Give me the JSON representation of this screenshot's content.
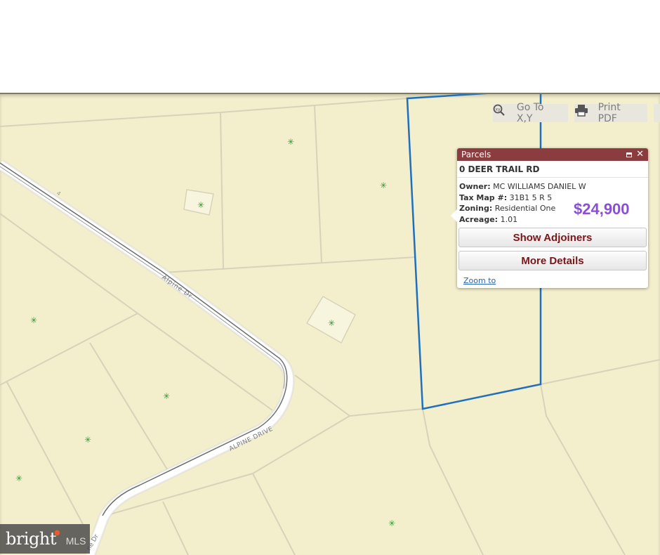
{
  "toolbar": {
    "goto_label": "Go To X,Y",
    "print_label": "Print PDF",
    "goto_icon": "zoom-xy-icon",
    "print_icon": "printer-icon"
  },
  "popup": {
    "header": "Parcels",
    "title": "0 DEER TRAIL RD",
    "fields": [
      {
        "label": "Owner:",
        "value": "MC WILLIAMS DANIEL W"
      },
      {
        "label": "Tax Map #:",
        "value": "31B1 5 R 5"
      },
      {
        "label": "Zoning:",
        "value": "Residential One"
      },
      {
        "label": "Acreage:",
        "value": "1.01"
      }
    ],
    "price": "$24,900",
    "show_adjoiners": "Show Adjoiners",
    "more_details": "More Details",
    "zoom_to": "Zoom to"
  },
  "map_labels": {
    "alpine_dr": "Alpine Dr",
    "alpine_drive": "ALPINE DRIVE",
    "lot_number": "4",
    "bottom_road": "ne Dr"
  },
  "brand": {
    "name": "bright",
    "suffix": "MLS"
  },
  "colors": {
    "parcel_fill": "#f3efcd",
    "selection_outline": "#1f6fbf",
    "popup_header": "#8b3c3f",
    "price": "#8a4fd6",
    "button_text": "#7b1518"
  }
}
